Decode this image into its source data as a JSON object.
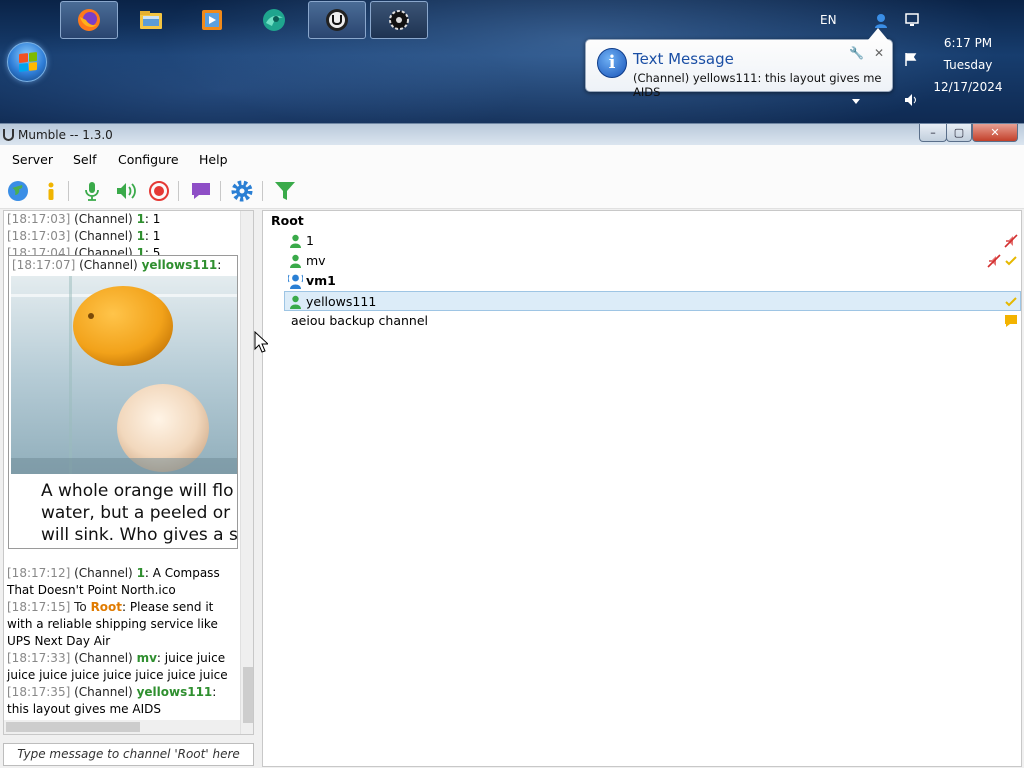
{
  "taskbar": {
    "apps": [
      {
        "name": "firefox-icon"
      },
      {
        "name": "file-explorer-icon"
      },
      {
        "name": "media-player-icon"
      },
      {
        "name": "browser-icon"
      },
      {
        "name": "mumble-icon"
      },
      {
        "name": "settings-app-icon"
      }
    ],
    "language": "EN",
    "clock": {
      "time": "6:17 PM",
      "day": "Tuesday",
      "date": "12/17/2024"
    }
  },
  "notification": {
    "title": "Text Message",
    "body": "(Channel) yellows111: this layout gives me AIDS"
  },
  "window": {
    "title": "Mumble -- 1.3.0",
    "controls": {
      "minimize": "–",
      "maximize": "▢",
      "close": "✕"
    }
  },
  "menu": [
    "Server",
    "Self",
    "Configure",
    "Help"
  ],
  "log": {
    "top_lines": [
      {
        "time": "[18:17:03]",
        "scope": "(Channel)",
        "user": "1",
        "text": "1"
      },
      {
        "time": "[18:17:03]",
        "scope": "(Channel)",
        "user": "1",
        "text": "1"
      },
      {
        "time": "[18:17:04]",
        "scope": "(Channel)",
        "user": "1",
        "text": "5"
      }
    ],
    "image_message": {
      "time": "[18:17:07]",
      "scope": "(Channel)",
      "user": "yellows111",
      "caption": [
        "A whole orange will flo",
        "water, but a peeled or",
        "will sink. Who gives a s"
      ]
    },
    "lower": [
      {
        "time": "[18:17:12]",
        "scope": "(Channel)",
        "user": "1",
        "text": "A Compass That Doesn't Point North.ico"
      },
      {
        "time": "[18:17:15]",
        "scope": "To",
        "user": "Root",
        "text": "Please send it with a reliable shipping service like UPS Next Day Air"
      },
      {
        "time": "[18:17:33]",
        "scope": "(Channel)",
        "user": "mv",
        "text": "juice juice juice juice juice juice juice juice juice"
      },
      {
        "time": "[18:17:35]",
        "scope": "(Channel)",
        "user": "yellows111",
        "text": "this layout gives me AIDS"
      }
    ]
  },
  "chat_input": {
    "placeholder": "Type message to channel 'Root' here"
  },
  "tree": {
    "root": "Root",
    "users": [
      {
        "name": "1",
        "status": "deafened"
      },
      {
        "name": "mv",
        "status": "deafened-authenticated"
      },
      {
        "name": "vm1",
        "status": "talking-self"
      },
      {
        "name": "yellows111",
        "status": "authenticated-selected"
      }
    ],
    "subchannel": "aeiou backup channel"
  },
  "colors": {
    "accent": "#1b4fa5",
    "user_name": "#2f8f2f",
    "root_name": "#e07b00",
    "selection": "#dcecf8"
  }
}
